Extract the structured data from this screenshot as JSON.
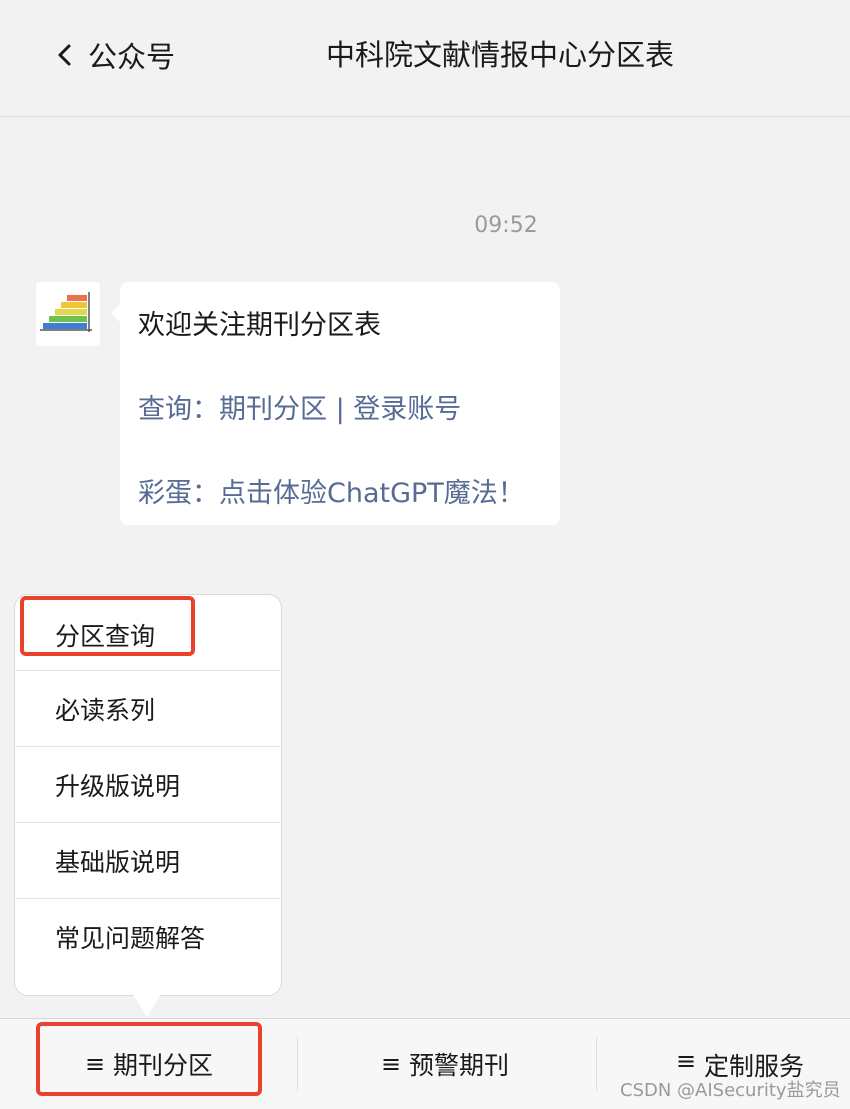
{
  "header": {
    "back_label": "公众号",
    "title": "中科院文献情报中心分区表"
  },
  "chat": {
    "timestamp": "09:52",
    "message": {
      "line1": "欢迎关注期刊分区表",
      "line2_prefix": "查询：",
      "line2_link1": "期刊分区",
      "line2_sep": " | ",
      "line2_link2": "登录账号",
      "line3_prefix": "彩蛋：",
      "line3_link": "点击体验ChatGPT魔法！"
    }
  },
  "menu_popup": {
    "items": [
      {
        "label": "分区查询"
      },
      {
        "label": "必读系列"
      },
      {
        "label": "升级版说明"
      },
      {
        "label": "基础版说明"
      },
      {
        "label": "常见问题解答"
      }
    ]
  },
  "bottom_menu": {
    "tabs": [
      {
        "icon": "≡",
        "label": "期刊分区"
      },
      {
        "icon": "≡",
        "label": "预警期刊"
      },
      {
        "icon": "≡",
        "label": "定制服务"
      }
    ]
  },
  "watermark": "CSDN @AISecurity盐究员",
  "colors": {
    "background": "#f2f2f2",
    "link": "#576b95",
    "highlight": "#e8412c",
    "bubble": "#ffffff"
  }
}
